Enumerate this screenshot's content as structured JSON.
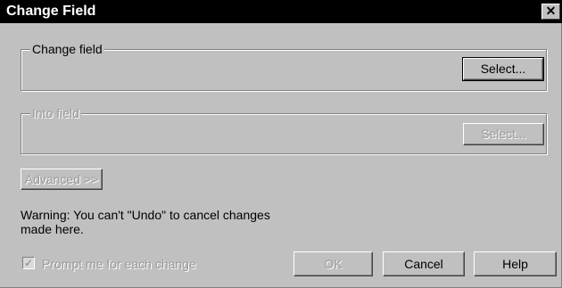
{
  "window": {
    "title": "Change Field",
    "close_glyph": "✕"
  },
  "change_field_group": {
    "label": "Change field",
    "select_button": "Select..."
  },
  "into_field_group": {
    "label": "Into field",
    "select_button": "Select..."
  },
  "advanced_button": "Advanced >>",
  "warning_text": "Warning: You can't \"Undo\" to cancel changes made here.",
  "prompt_checkbox": {
    "label": "Prompt me for each change",
    "checked": true,
    "check_glyph": "✓"
  },
  "buttons": {
    "ok": "OK",
    "cancel": "Cancel",
    "help": "Help"
  }
}
